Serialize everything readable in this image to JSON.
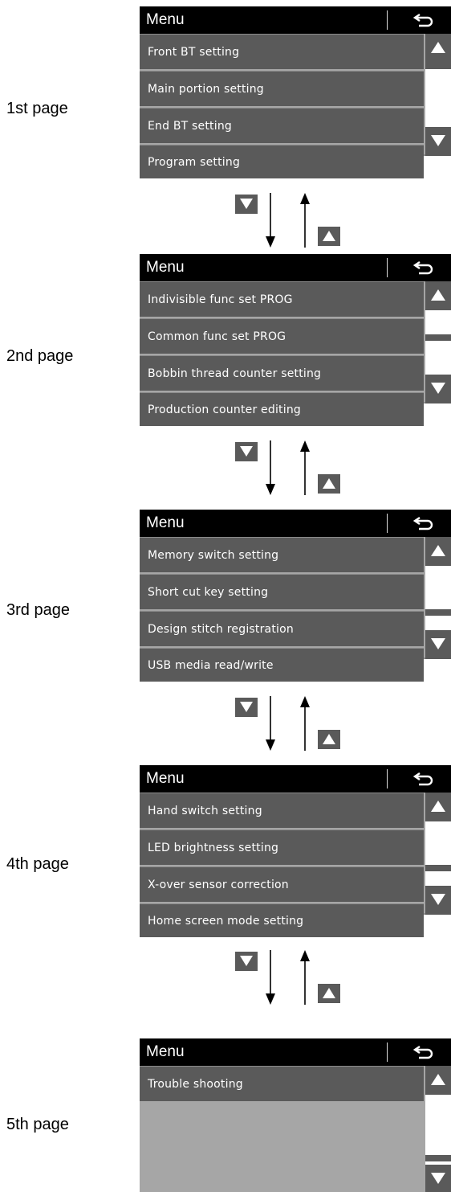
{
  "pages": [
    {
      "label": "1st page",
      "title": "Menu",
      "items": [
        "Front BT setting",
        "Main portion setting",
        "End BT setting",
        "Program setting"
      ]
    },
    {
      "label": "2nd page",
      "title": "Menu",
      "items": [
        "Indivisible func set PROG",
        "Common func set PROG",
        "Bobbin thread counter setting",
        "Production counter editing"
      ]
    },
    {
      "label": "3rd page",
      "title": "Menu",
      "items": [
        "Memory switch setting",
        "Short cut key setting",
        "Design stitch registration",
        "USB media read/write"
      ]
    },
    {
      "label": "4th page",
      "title": "Menu",
      "items": [
        "Hand switch setting",
        "LED brightness setting",
        "X-over sensor correction",
        "Home screen mode setting"
      ]
    },
    {
      "label": "5th page",
      "title": "Menu",
      "items": [
        "Trouble shooting"
      ]
    }
  ],
  "scroll_positions": [
    0.0,
    0.25,
    0.5,
    0.75,
    1.0
  ],
  "icons": {
    "back": "return-arrow-icon",
    "scroll_up": "triangle-up-icon",
    "scroll_down": "triangle-down-icon",
    "page_down": "page-down-button",
    "page_up": "page-up-button"
  },
  "colors": {
    "title_bar": "#000000",
    "menu_item": "#5a5a5a",
    "screen_bg": "#a6a6a6",
    "text": "#ffffff"
  }
}
